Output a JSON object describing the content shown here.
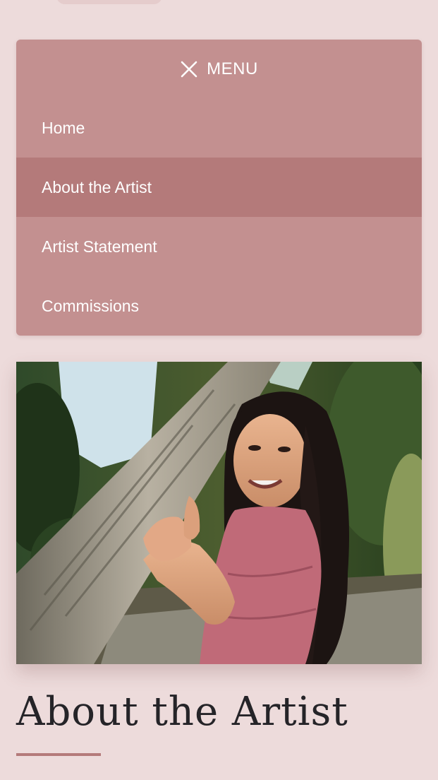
{
  "menu": {
    "toggle_label": "MENU",
    "toggle_icon": "close-icon",
    "items": [
      {
        "label": "Home",
        "active": false
      },
      {
        "label": "About the Artist",
        "active": true
      },
      {
        "label": "Artist Statement",
        "active": false
      },
      {
        "label": "Commissions",
        "active": false
      }
    ]
  },
  "page": {
    "title": "About the Artist"
  },
  "colors": {
    "background": "#eddbdb",
    "menu_background": "#c39090",
    "menu_active": "#b47a7a",
    "title_text": "#252428",
    "accent_rule": "#b47a7a"
  }
}
